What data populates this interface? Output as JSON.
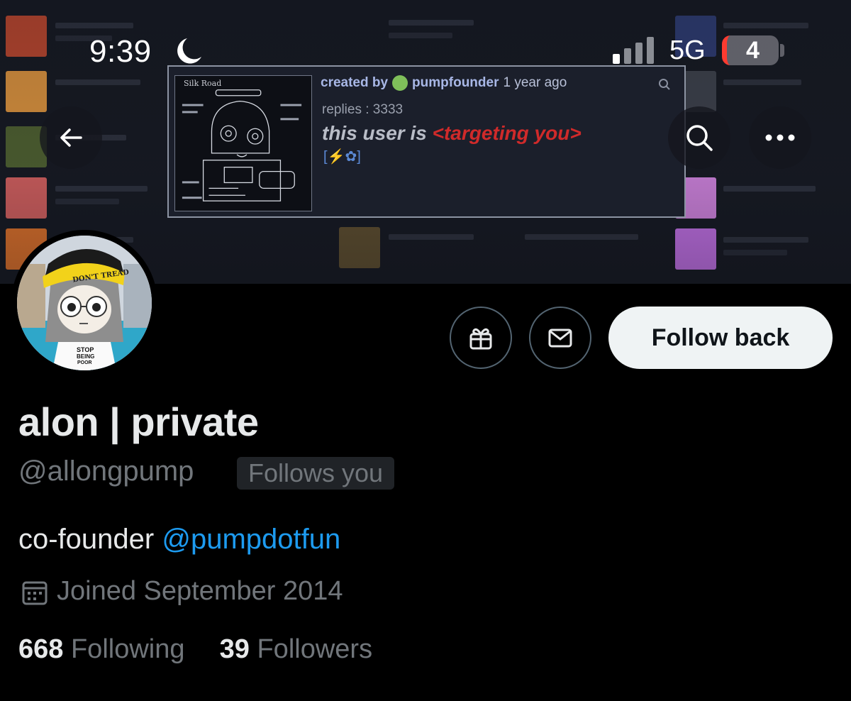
{
  "status_bar": {
    "time": "9:39",
    "network": "5G",
    "battery_level": "4",
    "icons": [
      "moon-icon",
      "signal-icon",
      "battery-icon"
    ]
  },
  "banner": {
    "card": {
      "thumb_title": "Silk Road",
      "created_by_label": "created by",
      "creator": "pumpfounder",
      "time_ago": "1 year ago",
      "replies": "replies : 3333",
      "user_line_prefix": "this user is",
      "user_line_highlight": "<targeting you>",
      "emoji_line_open": "[",
      "emoji_line_bolt": "⚡",
      "emoji_line_close": "✿]"
    }
  },
  "nav": {
    "back_icon": "arrow-left-icon",
    "search_icon": "search-icon",
    "more_icon": "more-icon"
  },
  "avatar": {
    "hat_text": "DON'T TREAD",
    "shirt_text_1": "STOP",
    "shirt_text_2": "BEING",
    "shirt_text_3": "POOR"
  },
  "actions": {
    "gift_icon": "gift-icon",
    "message_icon": "envelope-icon",
    "follow_back_label": "Follow back"
  },
  "profile": {
    "display_name": "alon | private",
    "handle": "@allongpump",
    "follows_you": "Follows you",
    "bio_prefix": "co-founder ",
    "bio_mention": "@pumpdotfun",
    "joined": "Joined September 2014",
    "following_count": "668",
    "following_label": "Following",
    "followers_count": "39",
    "followers_label": "Followers"
  },
  "colors": {
    "background": "#000000",
    "accent_blue": "#1d9bf0",
    "muted_text": "#71767b",
    "button_light": "#eff3f4",
    "warning_red": "#d02a2a"
  }
}
